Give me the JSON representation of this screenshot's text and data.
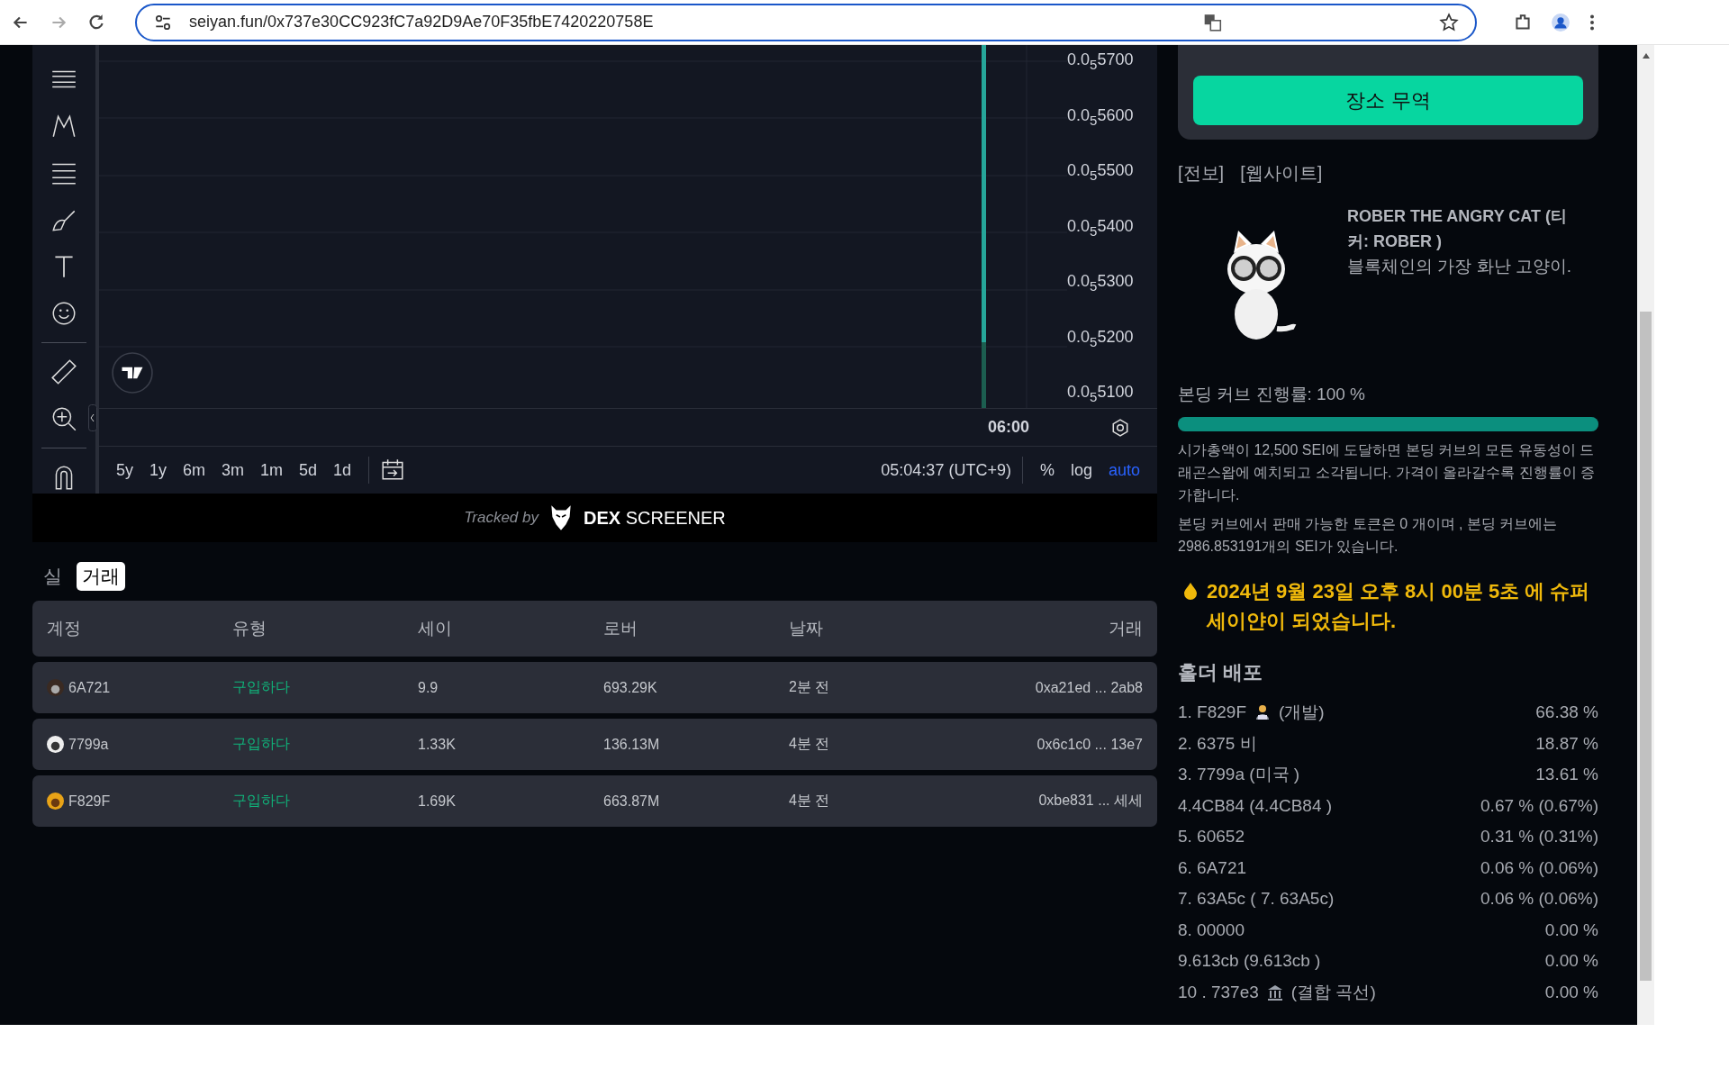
{
  "browser": {
    "url": "seiyan.fun/0x737e30CC923fC7a92D9Ae70F35fbE7420220758E"
  },
  "chart": {
    "price_labels": [
      "0.0$_{5}$5700",
      "0.0$_{5}$5600",
      "0.0$_{5}$5500",
      "0.0$_{5}$5400",
      "0.0$_{5}$5300",
      "0.0$_{5}$5200",
      "0.0$_{5}$5100"
    ],
    "time_label": "06:00",
    "ranges": [
      "5y",
      "1y",
      "6m",
      "3m",
      "1m",
      "5d",
      "1d"
    ],
    "clock": "05:04:37 (UTC+9)",
    "scale_options": [
      {
        "label": "%",
        "selected": false
      },
      {
        "label": "log",
        "selected": false
      },
      {
        "label": "auto",
        "selected": true
      }
    ]
  },
  "tracked_by": {
    "prefix": "Tracked by",
    "brand": "**DEX** SCREENER"
  },
  "tabs": [
    {
      "label": "실",
      "selected": false
    },
    {
      "label": "거래",
      "selected": true
    }
  ],
  "trades": {
    "columns": [
      "계정",
      "유형",
      "세이",
      "로버",
      "날짜",
      "거래"
    ],
    "rows": [
      {
        "account": "6A721",
        "type": "구입하다",
        "sei": "9.9",
        "rober": "693.29K",
        "date": "2분 전",
        "tx": "0xa21ed ... 2ab8"
      },
      {
        "account": "7799a",
        "type": "구입하다",
        "sei": "1.33K",
        "rober": "136.13M",
        "date": "4분 전",
        "tx": "0x6c1c0 ... 13e7"
      },
      {
        "account": "F829F",
        "type": "구입하다",
        "sei": "1.69K",
        "rober": "663.87M",
        "date": "4분 전",
        "tx": "0xbe831 ... 세세"
      }
    ]
  },
  "trade_button": "장소 무역",
  "links": [
    "[전보]",
    "[웹사이트]"
  ],
  "token": {
    "title": "ROBER THE ANGRY CAT (티커: ROBER )",
    "description": "블록체인의 가장 화난 고양이."
  },
  "bonding": {
    "label": "본딩 커브 진행률: 100 %",
    "level": 1,
    "notes": [
      "시가총액이 12,500 SEI에 도달하면 본딩 커브의 모든 유동성이 드래곤스왑에 예치되고 소각됩니다. 가격이 올라갈수록 진행률이 증가합니다.",
      "본딩 커브에서 판매 가능한 토큰은 0 개이며 , 본딩 커브에는 2986.853191개의 SEI가 있습니다."
    ]
  },
  "notice": "2024년 9월 23일 오후 8시 00분 5초 에 슈퍼 세이얀이 되었습니다.",
  "holders": {
    "title": "홀더 배포",
    "items": [
      {
        "name": "1. F829F",
        "kind": "developer",
        "note": "(개발)",
        "share": "66.38 %"
      },
      {
        "name": "2. 6375 비",
        "share": "18.87 %"
      },
      {
        "name": "3. 7799a (미국 )",
        "share": "13.61 %"
      },
      {
        "name": "4.4CB84 (4.4CB84 )",
        "share": "0.67 % (0.67%)"
      },
      {
        "name": "5. 60652",
        "share": "0.31 % (0.31%)"
      },
      {
        "name": "6. 6A721",
        "share": "0.06 % (0.06%)"
      },
      {
        "name": "7. 63A5c ( 7. 63A5c)",
        "share": "0.06 % (0.06%)"
      },
      {
        "name": "8. 00000",
        "share": "0.00 %"
      },
      {
        "name": "9.613cb (9.613cb )",
        "share": "0.00 %"
      },
      {
        "name": "10 . 737e3",
        "kind": "curve",
        "note": "(결합 곡선)",
        "share": "0.00 %"
      }
    ]
  }
}
